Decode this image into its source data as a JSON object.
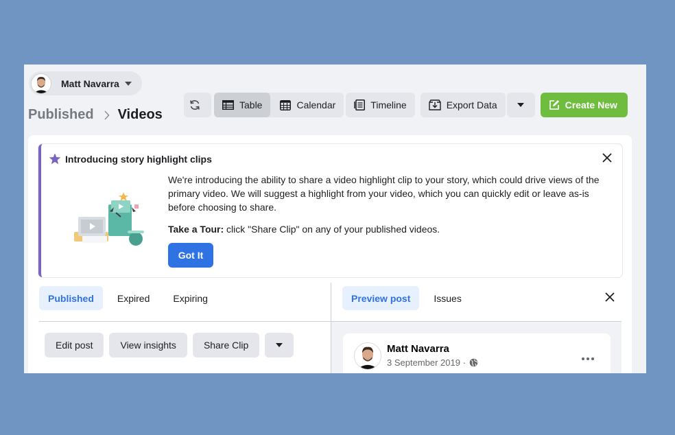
{
  "profile": {
    "name": "Matt Navarra"
  },
  "breadcrumb": {
    "parent": "Published",
    "current": "Videos"
  },
  "toolbar": {
    "table_label": "Table",
    "calendar_label": "Calendar",
    "timeline_label": "Timeline",
    "export_label": "Export Data",
    "create_label": "Create New"
  },
  "banner": {
    "title": "Introducing story highlight clips",
    "body": "We're introducing the ability to share a video highlight clip to your story, which could drive views of the primary video. We will suggest a highlight from your video, which you can quickly edit or leave as-is before choosing to share.",
    "tour_label": "Take a Tour:",
    "tour_text": " click \"Share Clip\" on any of your published videos.",
    "button": "Got It"
  },
  "left_tabs": [
    "Published",
    "Expired",
    "Expiring"
  ],
  "actions": {
    "edit": "Edit post",
    "insights": "View insights",
    "share": "Share Clip"
  },
  "right_tabs": [
    "Preview post",
    "Issues"
  ],
  "post": {
    "author": "Matt Navarra",
    "date": "3 September 2019 ·"
  },
  "colors": {
    "accent": "#2e72e3",
    "create": "#6ebd3f",
    "banner_stripe": "#7b64c0"
  }
}
